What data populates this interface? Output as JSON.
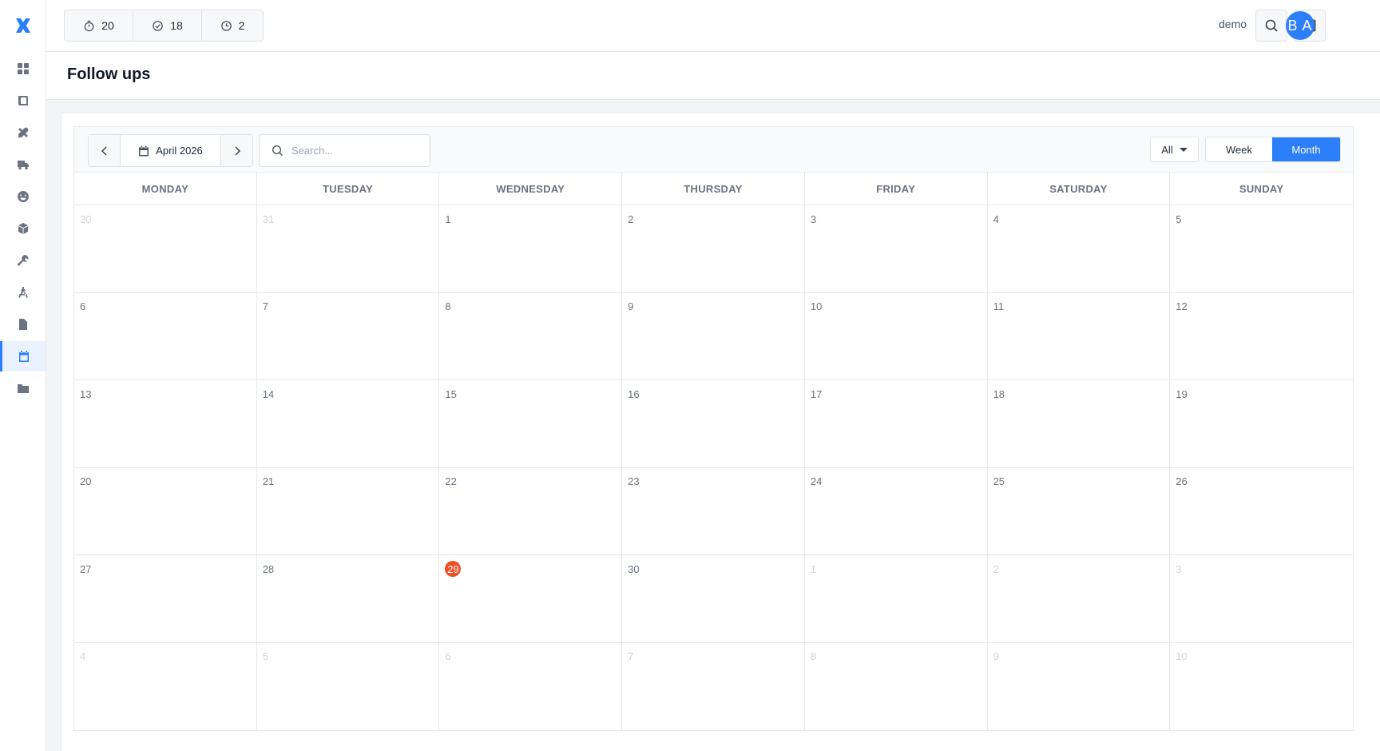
{
  "topbar": {
    "counters": [
      {
        "icon": "stopwatch-icon",
        "value": "20"
      },
      {
        "icon": "check-circle-icon",
        "value": "18"
      },
      {
        "icon": "clock-icon",
        "value": "2"
      }
    ],
    "user_name": "demo",
    "avatar_initials": "B A",
    "accent_color": "#2d7ff9"
  },
  "sidebar": {
    "items": [
      {
        "icon": "dashboard-icon"
      },
      {
        "icon": "book-icon"
      },
      {
        "icon": "tools-icon"
      },
      {
        "icon": "truck-icon"
      },
      {
        "icon": "smile-icon"
      },
      {
        "icon": "boxes-icon"
      },
      {
        "icon": "wrench-icon"
      },
      {
        "icon": "compass-icon"
      },
      {
        "icon": "file-icon"
      },
      {
        "icon": "calendar-icon",
        "active": true
      },
      {
        "icon": "folder-icon"
      }
    ]
  },
  "page": {
    "title": "Follow ups"
  },
  "calendar": {
    "month_label": "April 2026",
    "search_placeholder": "Search...",
    "filter_value": "All",
    "view_week_label": "Week",
    "view_month_label": "Month",
    "active_view": "Month",
    "today_color": "#f04e23",
    "weekdays": [
      "MONDAY",
      "TUESDAY",
      "WEDNESDAY",
      "THURSDAY",
      "FRIDAY",
      "SATURDAY",
      "SUNDAY"
    ],
    "days": [
      {
        "n": "30",
        "out": true
      },
      {
        "n": "31",
        "out": true
      },
      {
        "n": "1"
      },
      {
        "n": "2"
      },
      {
        "n": "3"
      },
      {
        "n": "4"
      },
      {
        "n": "5"
      },
      {
        "n": "6"
      },
      {
        "n": "7"
      },
      {
        "n": "8"
      },
      {
        "n": "9"
      },
      {
        "n": "10"
      },
      {
        "n": "11"
      },
      {
        "n": "12"
      },
      {
        "n": "13"
      },
      {
        "n": "14"
      },
      {
        "n": "15"
      },
      {
        "n": "16"
      },
      {
        "n": "17"
      },
      {
        "n": "18"
      },
      {
        "n": "19"
      },
      {
        "n": "20"
      },
      {
        "n": "21"
      },
      {
        "n": "22"
      },
      {
        "n": "23"
      },
      {
        "n": "24"
      },
      {
        "n": "25"
      },
      {
        "n": "26"
      },
      {
        "n": "27"
      },
      {
        "n": "28"
      },
      {
        "n": "29",
        "today": true
      },
      {
        "n": "30"
      },
      {
        "n": "1",
        "out": true
      },
      {
        "n": "2",
        "out": true
      },
      {
        "n": "3",
        "out": true
      },
      {
        "n": "4",
        "out": true
      },
      {
        "n": "5",
        "out": true
      },
      {
        "n": "6",
        "out": true
      },
      {
        "n": "7",
        "out": true
      },
      {
        "n": "8",
        "out": true
      },
      {
        "n": "9",
        "out": true
      },
      {
        "n": "10",
        "out": true
      }
    ]
  }
}
